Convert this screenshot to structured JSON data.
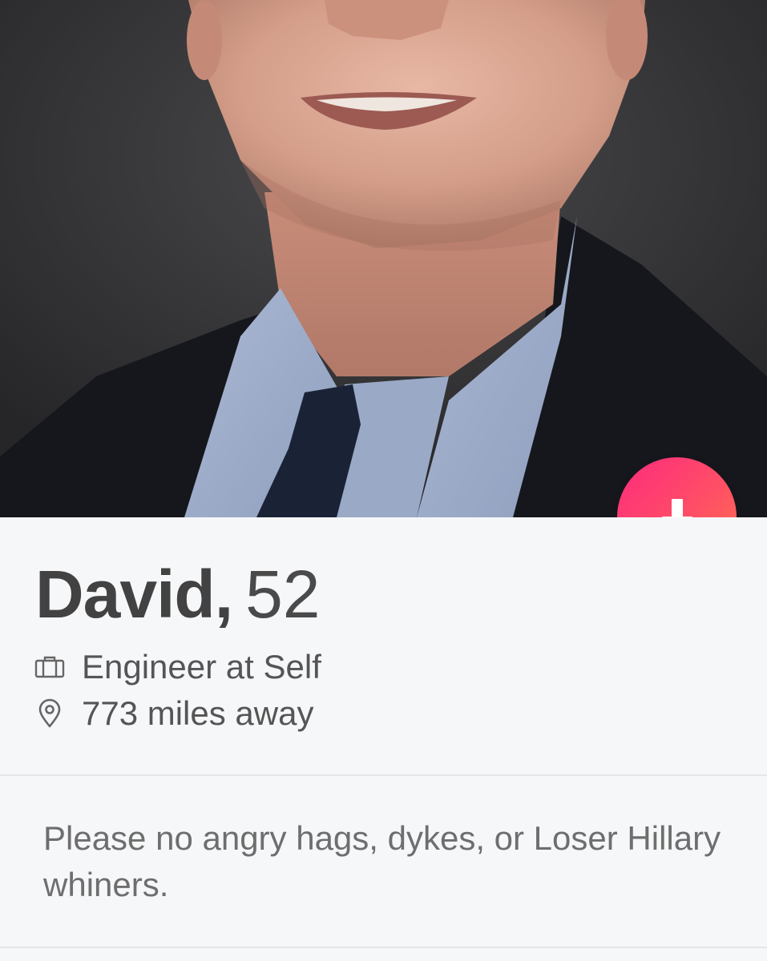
{
  "profile": {
    "name": "David,",
    "age": "52",
    "job": "Engineer at Self",
    "distance": "773 miles away",
    "bio": "Please no angry hags, dykes, or Loser Hillary whiners."
  },
  "icons": {
    "job": "briefcase-icon",
    "distance": "location-pin-icon",
    "action": "arrow-down-icon"
  },
  "colors": {
    "accent_start": "#fd2a7c",
    "accent_end": "#ff7447",
    "name_text": "#424242",
    "meta_text": "#555555",
    "bio_text": "#6e6e6e",
    "background": "#f6f7f9"
  }
}
